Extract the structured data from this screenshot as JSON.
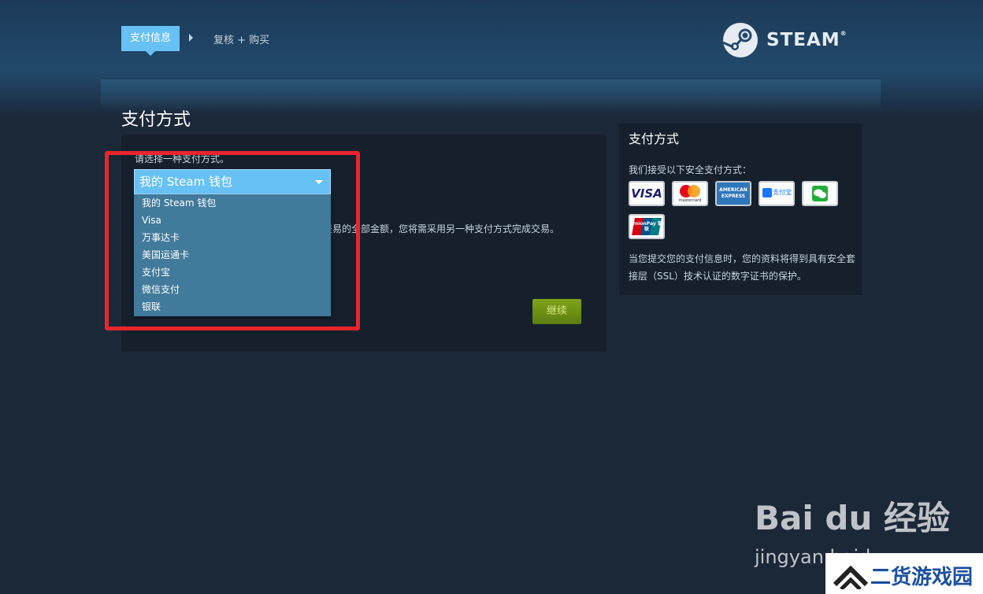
{
  "breadcrumb": {
    "active": "支付信息",
    "next": "复核 + 购买"
  },
  "logo": {
    "text": "STEAM",
    "reg": "®"
  },
  "page_title": "支付方式",
  "main": {
    "prompt": "请选择一种支付方式。",
    "selected_value": "我的 Steam 钱包",
    "options": [
      "我的 Steam 钱包",
      "Visa",
      "万事达卡",
      "美国运通卡",
      "支付宝",
      "微信支付",
      "银联"
    ],
    "note": "交易的全部金额，您将需采用另一种支付方式完成交易。",
    "continue_label": "继续"
  },
  "sidebar": {
    "title": "支付方式",
    "accept_text": "我们接受以下安全支付方式：",
    "cards": [
      {
        "icon": "visa-card-icon",
        "label": "VISA"
      },
      {
        "icon": "mastercard-icon",
        "label": "mastercard"
      },
      {
        "icon": "amex-icon",
        "label": "AMERICAN EXPRESS"
      },
      {
        "icon": "alipay-icon",
        "label": "支付宝"
      },
      {
        "icon": "wechat-pay-icon",
        "label": ""
      },
      {
        "icon": "unionpay-icon",
        "label": "UnionPay 银联"
      }
    ],
    "ssl_text": "当您提交您的支付信息时，您的资料将得到具有安全套接层（SSL）技术认证的数字证书的保护。"
  },
  "watermarks": {
    "baidu": "Bai du 经验",
    "jingyan": "jingyan.baidu",
    "site": "二货游戏园"
  },
  "colors": {
    "background": "#1b2838",
    "accent": "#67c1f5",
    "dropdown": "#417a9b",
    "continue": "#6f9415",
    "highlight_box": "#e8262c"
  }
}
